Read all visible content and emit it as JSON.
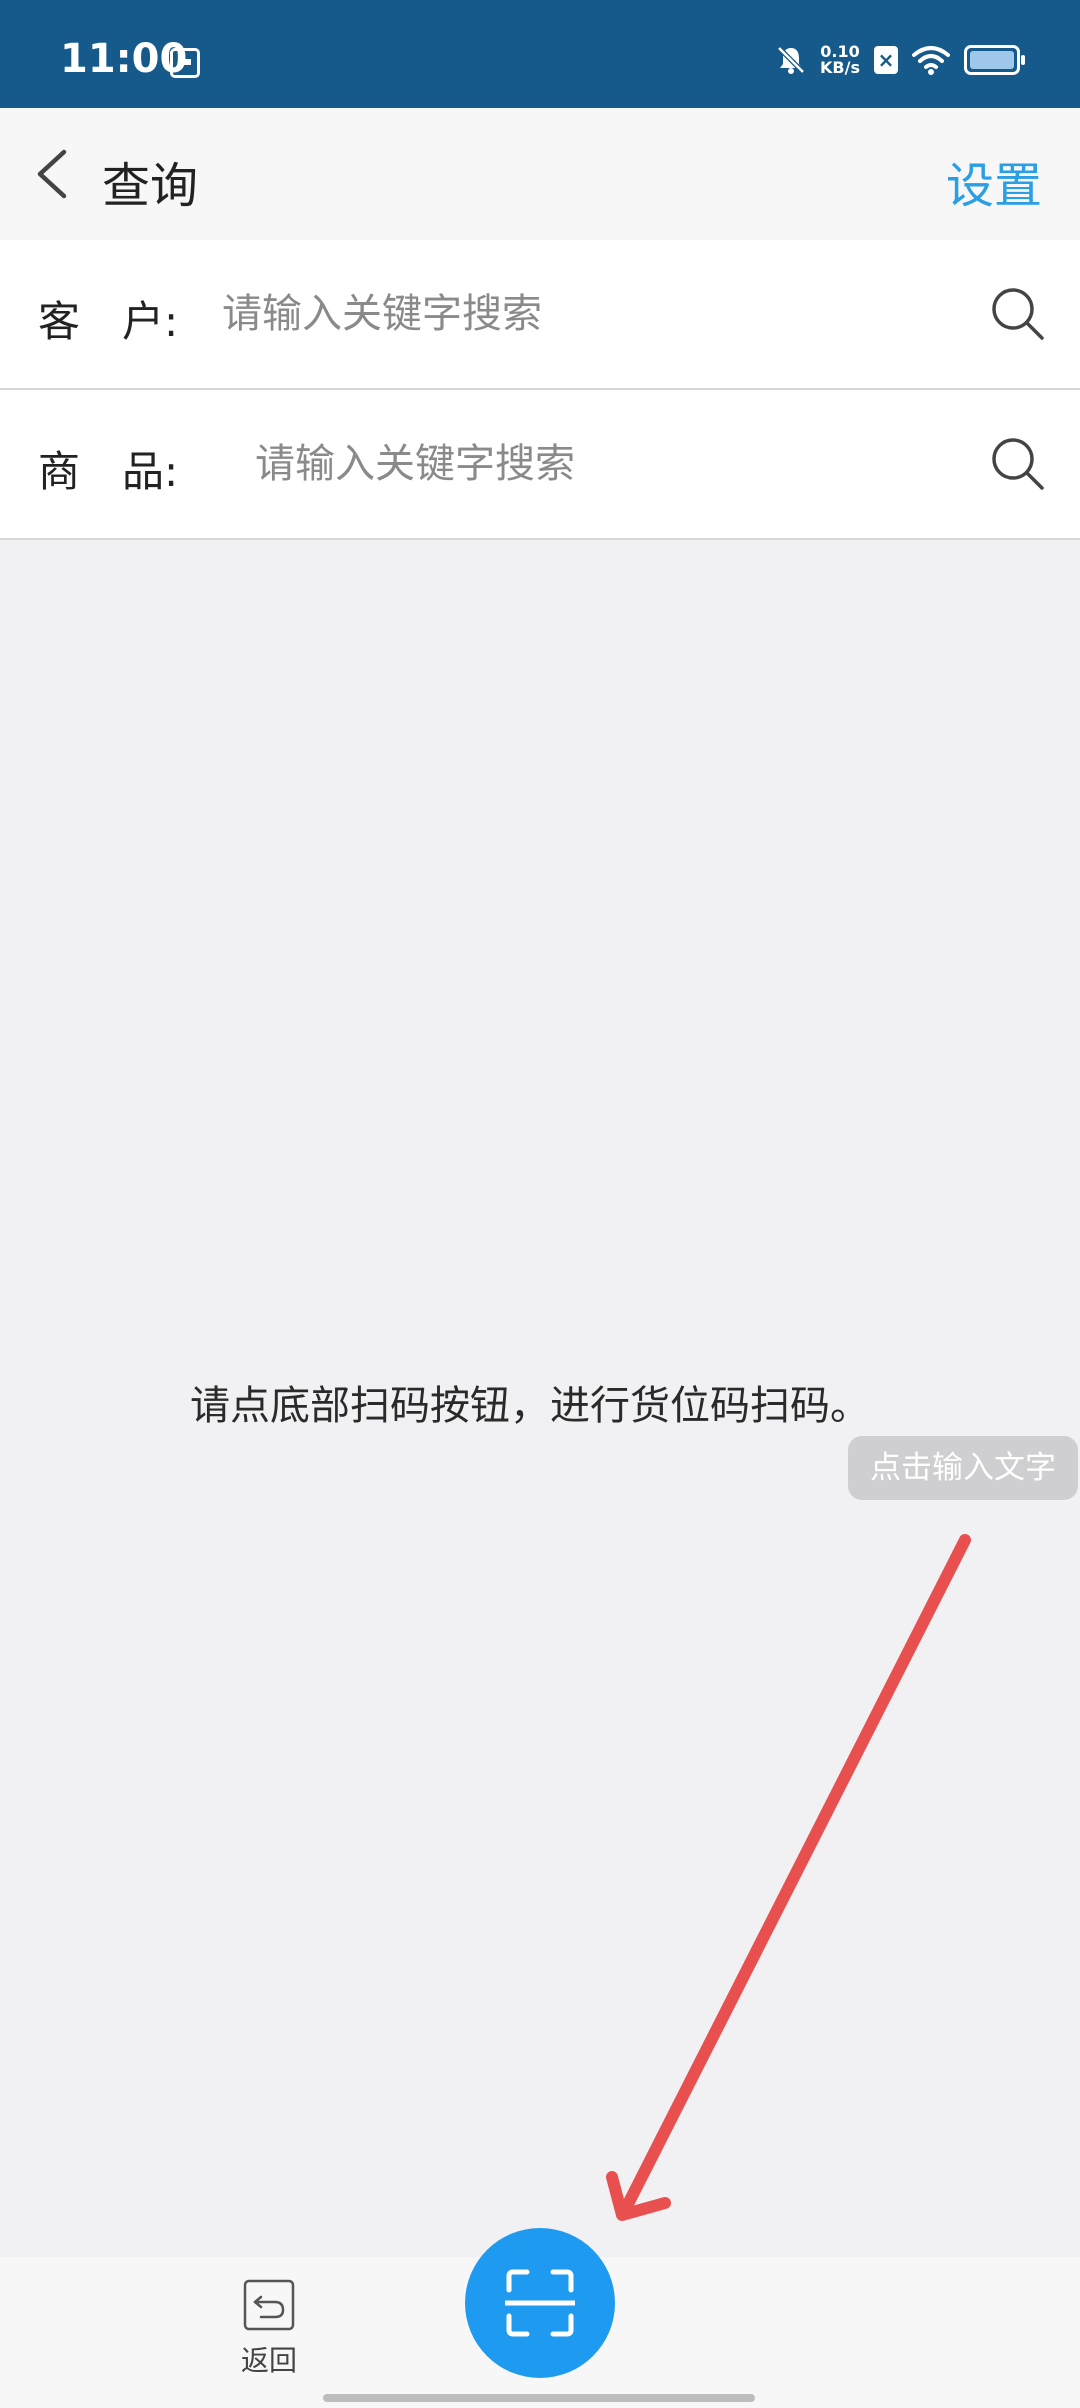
{
  "status_bar": {
    "time": "11:00",
    "net_speed_value": "0.10",
    "net_speed_unit": "KB/s",
    "icons": [
      "calendar-icon",
      "bell-off-icon",
      "close-box-icon",
      "wifi-icon",
      "battery-icon"
    ]
  },
  "header": {
    "title": "查询",
    "settings_label": "设置"
  },
  "search": {
    "customer_label": "客　户:",
    "customer_placeholder": "请输入关键字搜索",
    "product_label": "商　品:",
    "product_placeholder": "请输入关键字搜索"
  },
  "content": {
    "instruction": "请点底部扫码按钮，进行货位码扫码。",
    "tooltip": "点击输入文字"
  },
  "bottom_bar": {
    "back_label": "返回"
  },
  "colors": {
    "status_bar": "#165a8c",
    "accent": "#2a9fe4",
    "scan_button": "#1e9bf0",
    "annotation_arrow": "#e85050"
  }
}
